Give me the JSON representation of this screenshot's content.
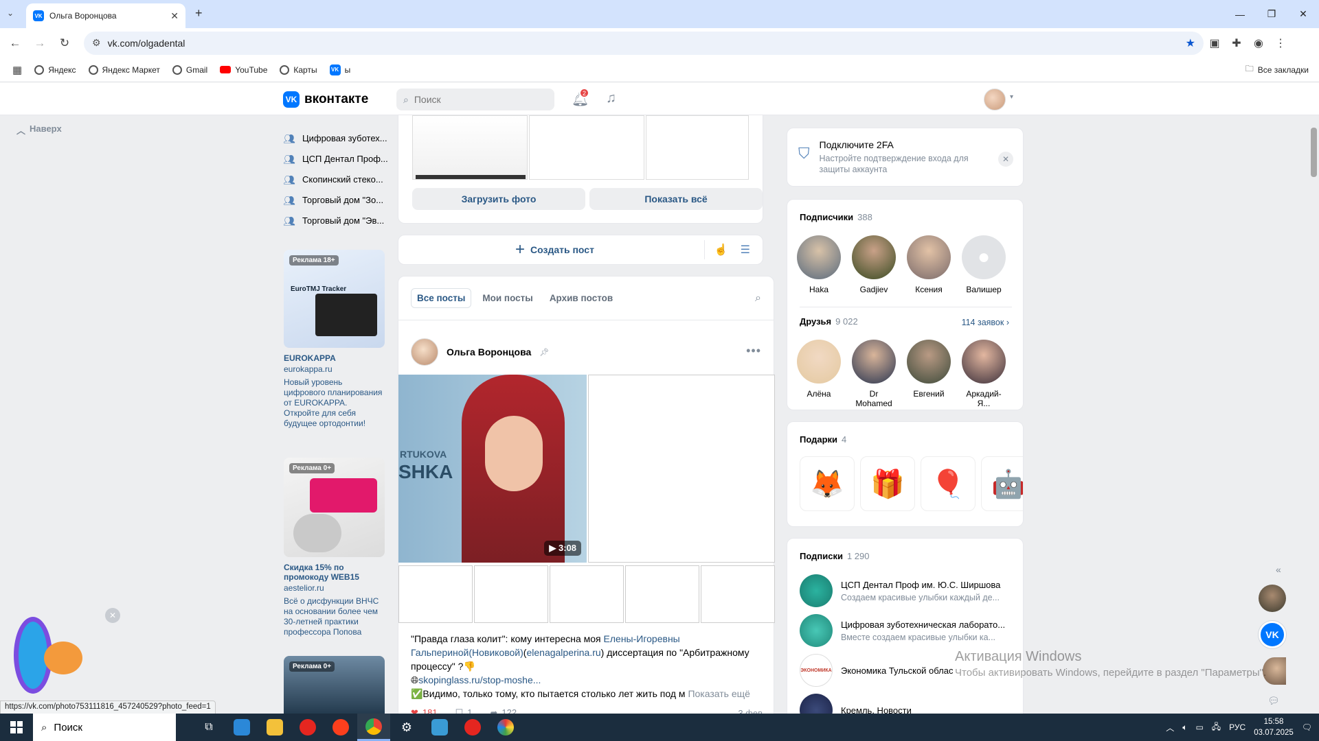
{
  "browser": {
    "tab_title": "Ольга Воронцова",
    "url": "vk.com/olgadental",
    "bookmarks": [
      "Яндекс",
      "Яндекс Маркет",
      "Gmail",
      "YouTube",
      "Карты",
      "ы"
    ],
    "all_bookmarks": "Все закладки",
    "hover_url": "https://vk.com/photo753111816_457240529?photo_feed=1"
  },
  "vk": {
    "logo": "вконтакте",
    "search_placeholder": "Поиск",
    "notif_count": "2",
    "back_to_top": "Наверх"
  },
  "left_groups": [
    "Цифровая зуботех...",
    "ЦСП Дентал Проф...",
    "Скопинский стеко...",
    "Торговый дом \"Зо...",
    "Торговый дом \"Эв..."
  ],
  "ads": [
    {
      "badge": "Реклама 18+",
      "title": "EUROKAPPA",
      "domain": "eurokappa.ru",
      "text": "Новый уровень цифрового планирования от EUROKAPPA. Откройте для себя будущее ортодонтии!",
      "img_text": "EuroTMJ Tracker"
    },
    {
      "badge": "Реклама 0+",
      "title": "Скидка 15% по промокоду WEB15",
      "domain": "aestelior.ru",
      "text": "Всё о дисфункции ВНЧС на основании более чем 30-летней практики профессора Попова"
    },
    {
      "badge": "Реклама 0+"
    }
  ],
  "photos": {
    "upload": "Загрузить фото",
    "show_all": "Показать всё"
  },
  "create_post": "Создать пост",
  "feed": {
    "tabs": [
      "Все посты",
      "Мои посты",
      "Архив постов"
    ],
    "post": {
      "author": "Ольга Воронцова",
      "video_text_1": "RTUKOVA",
      "video_text_2": "SHKA",
      "duration": "3:08",
      "text_1": "\"Правда глаза колит\": кому интересна моя ",
      "link_1": "Елены-Игоревны Гальпериной(Новиковой)",
      "text_2": "(",
      "link_2": "elenagalperina.ru",
      "text_3": ") диссертация по \"Арбитражному процессу\" ?👎",
      "link_3": "skopinglass.ru/stop-moshe...",
      "text_4": "✅Видимо, только тому, кто пытается столько лет жить под м",
      "show_more": "Показать ещё",
      "likes": "181",
      "comments": "1",
      "reposts": "122",
      "date": "3 фев"
    }
  },
  "twofa": {
    "title": "Подключите 2FA",
    "subtitle": "Настройте подтверждение входа для защиты аккаунта"
  },
  "followers": {
    "title": "Подписчики",
    "count": "388",
    "people": [
      "Haka",
      "Gadjiev",
      "Ксения",
      "Валишер"
    ]
  },
  "friends": {
    "title": "Друзья",
    "count": "9 022",
    "requests": "114 заявок",
    "people": [
      "Алёна",
      "Dr Mohamed",
      "Евгений",
      "Аркадий-Я..."
    ]
  },
  "gifts": {
    "title": "Подарки",
    "count": "4"
  },
  "subscriptions": {
    "title": "Подписки",
    "count": "1 290",
    "items": [
      {
        "name": "ЦСП Дентал Проф им. Ю.С. Ширшова",
        "desc": "Создаем красивые улыбки каждый де..."
      },
      {
        "name": "Цифровая зуботехническая лаборато...",
        "desc": "Вместе создаем красивые улыбки ка..."
      },
      {
        "name": "Экономика Тульской облас",
        "desc": ""
      },
      {
        "name": "Кремль. Новости",
        "desc": ""
      }
    ]
  },
  "watermark": {
    "line1": "Активация Windows",
    "line2": "Чтобы активировать Windows, перейдите в раздел \"Параметры\"."
  },
  "taskbar": {
    "search": "Поиск",
    "lang": "РУС",
    "time": "15:58",
    "date": "03.07.2025"
  },
  "colors": {
    "vk_blue": "#0077ff",
    "link": "#2a5885",
    "taskbar": "#1b2d3e"
  }
}
